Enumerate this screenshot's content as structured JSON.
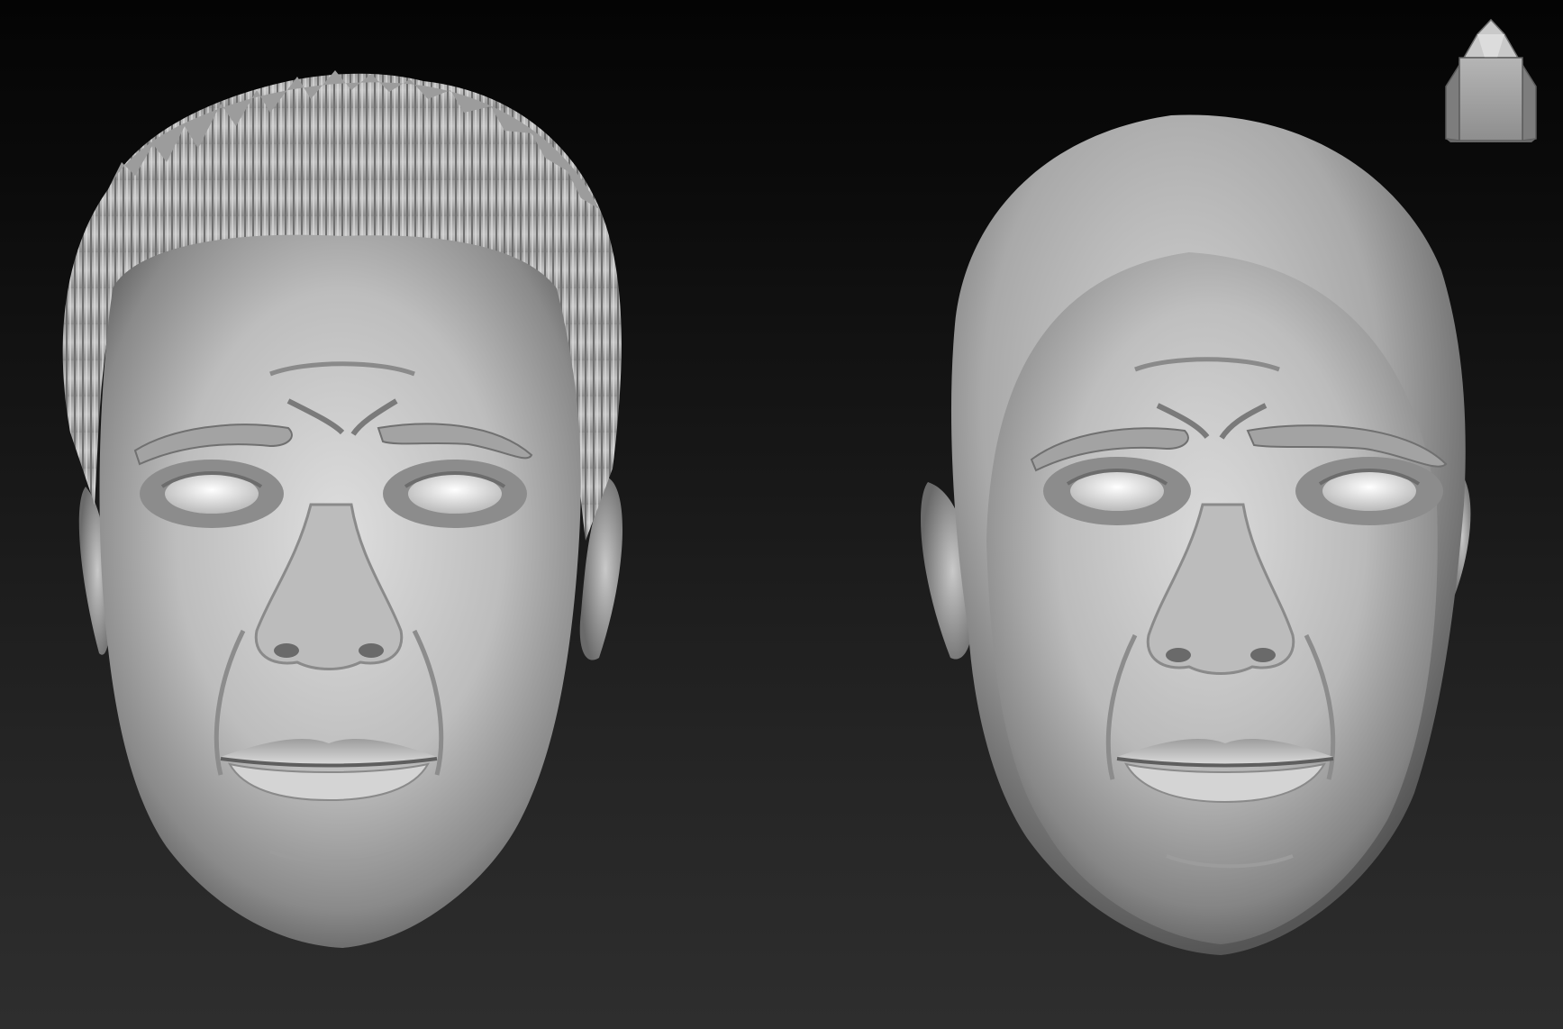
{
  "viewport": {
    "background_top": "#050505",
    "background_bottom": "#2e2e2e",
    "material_color": "#c8c8c8"
  },
  "models": [
    {
      "name": "head-with-hair",
      "has_hair": true
    },
    {
      "name": "head-bald",
      "has_hair": false
    }
  ],
  "nav_cube": {
    "icon": "navigation-cube-icon",
    "face": "front"
  }
}
